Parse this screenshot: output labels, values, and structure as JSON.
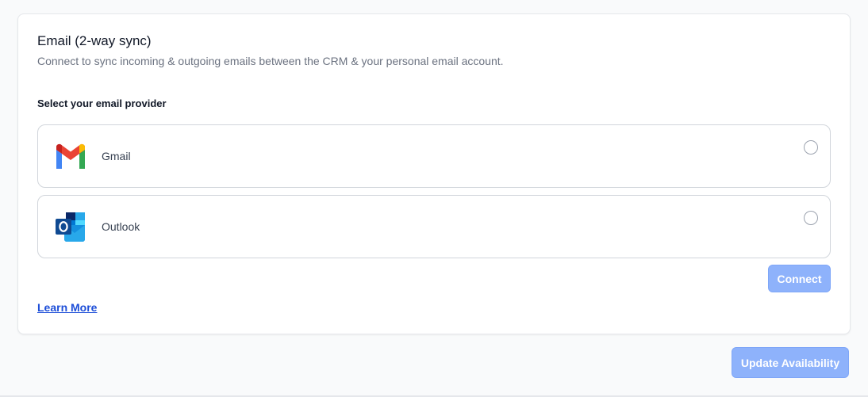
{
  "email_section": {
    "title": "Email (2-way sync)",
    "subtitle": "Connect to sync incoming & outgoing emails between the CRM & your personal email account.",
    "provider_label": "Select your email provider",
    "providers": [
      {
        "name": "Gmail",
        "icon": "gmail-icon",
        "selected": false
      },
      {
        "name": "Outlook",
        "icon": "outlook-icon",
        "selected": false
      }
    ],
    "connect_label": "Connect",
    "learn_more_label": "Learn More"
  },
  "footer": {
    "update_label": "Update Availability"
  },
  "colors": {
    "primary_disabled": "#8eb2fb",
    "link": "#1d4ed8"
  }
}
